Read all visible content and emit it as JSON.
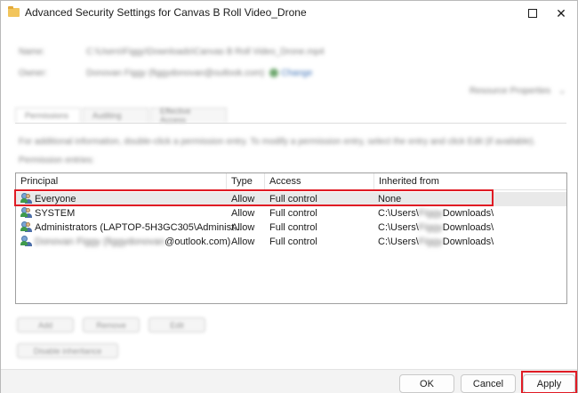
{
  "window": {
    "title": "Advanced Security Settings for Canvas B Roll Video_Drone"
  },
  "header": {
    "name_label": "Name:",
    "name_value": "C:\\Users\\Figgy\\Downloads\\Canvas B Roll Video_Drone.mp4",
    "owner_label": "Owner:",
    "owner_value": "Donovan Figgy (figgydonovan@outlook.com)",
    "owner_change": "Change",
    "resource_properties": "Resource Properties"
  },
  "tabs": [
    {
      "label": "Permissions"
    },
    {
      "label": "Auditing"
    },
    {
      "label": "Effective Access"
    }
  ],
  "info_text": "For additional information, double-click a permission entry. To modify a permission entry, select the entry and click Edit (if available).",
  "entries_label": "Permission entries:",
  "table": {
    "columns": [
      "Principal",
      "Type",
      "Access",
      "Inherited from"
    ],
    "rows": [
      {
        "principal": "Everyone",
        "type": "Allow",
        "access": "Full control",
        "inherited": "None"
      },
      {
        "principal": "SYSTEM",
        "type": "Allow",
        "access": "Full control",
        "inherited_pre": "C:\\Users\\",
        "inherited_blur": "Figgy",
        "inherited_post": "Downloads\\"
      },
      {
        "principal": "Administrators (LAPTOP-5H3GC305\\Administ...",
        "type": "Allow",
        "access": "Full control",
        "inherited_pre": "C:\\Users\\",
        "inherited_blur": "Figgy",
        "inherited_post": "Downloads\\"
      },
      {
        "principal_blur": "Donovan Figgy (figgydonovan",
        "principal_post": "@outlook.com)",
        "type": "Allow",
        "access": "Full control",
        "inherited_pre": "C:\\Users\\",
        "inherited_blur": "Figgy",
        "inherited_post": "Downloads\\"
      }
    ]
  },
  "actions": {
    "add": "Add",
    "remove": "Remove",
    "edit": "Edit",
    "disable_inheritance": "Disable inheritance"
  },
  "footer": {
    "ok": "OK",
    "cancel": "Cancel",
    "apply": "Apply"
  },
  "colors": {
    "highlight": "#e01b24",
    "selected_row": "#e9e9e9"
  }
}
